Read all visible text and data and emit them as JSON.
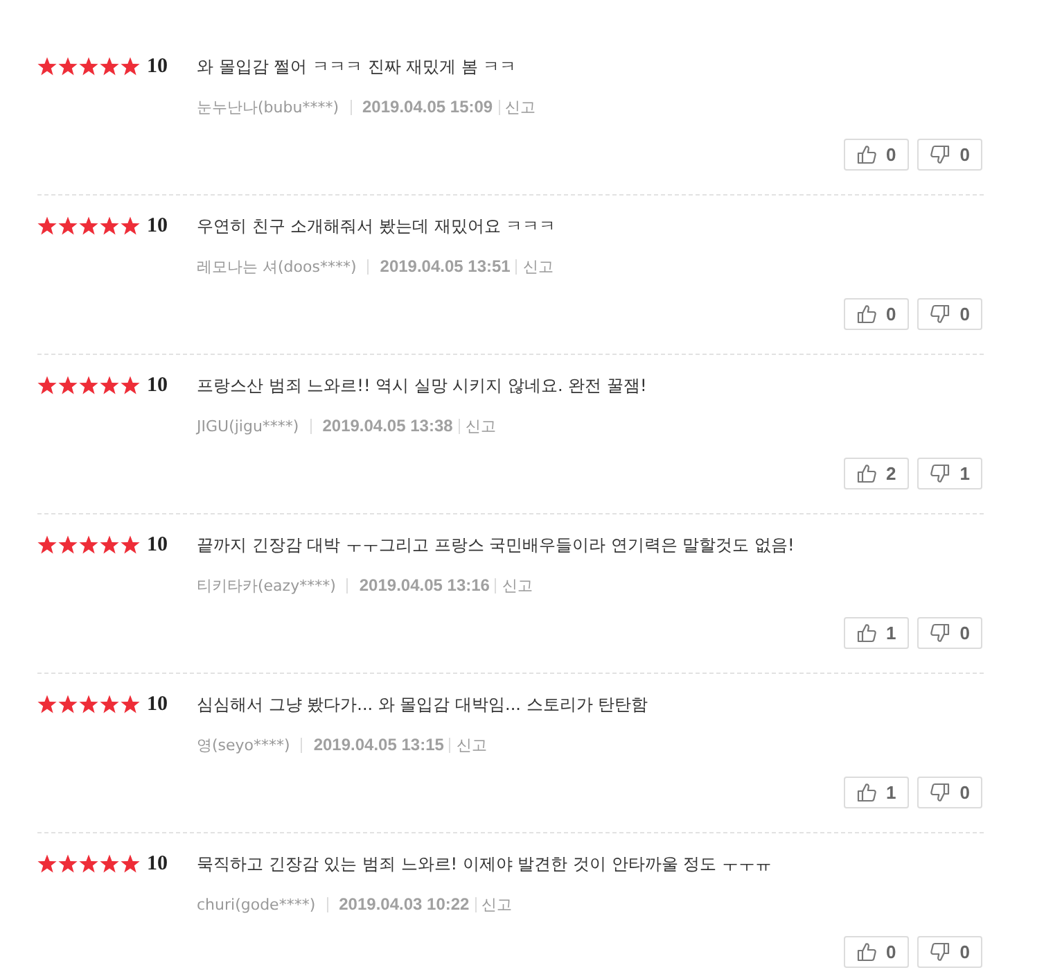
{
  "reviews": [
    {
      "stars": 5,
      "score": "10",
      "comment": "와 몰입감 쩔어 ㅋㅋㅋ 진짜 재밌게 봄 ㅋㅋ",
      "author": "눈누난나(bubu****)",
      "date": "2019.04.05 15:09",
      "report": "신고",
      "likes": "0",
      "dislikes": "0"
    },
    {
      "stars": 5,
      "score": "10",
      "comment": "우연히 친구 소개해줘서 봤는데 재밌어요 ㅋㅋㅋ",
      "author": "레모나는 셔(doos****)",
      "date": "2019.04.05 13:51",
      "report": "신고",
      "likes": "0",
      "dislikes": "0"
    },
    {
      "stars": 5,
      "score": "10",
      "comment": "프랑스산 범죄 느와르!! 역시 실망 시키지 않네요. 완전 꿀잼!",
      "author": "JIGU(jigu****)",
      "date": "2019.04.05 13:38",
      "report": "신고",
      "likes": "2",
      "dislikes": "1"
    },
    {
      "stars": 5,
      "score": "10",
      "comment": "끝까지 긴장감 대박 ㅜㅜ그리고 프랑스 국민배우들이라 연기력은 말할것도 없음!",
      "author": "티키타카(eazy****)",
      "date": "2019.04.05 13:16",
      "report": "신고",
      "likes": "1",
      "dislikes": "0"
    },
    {
      "stars": 5,
      "score": "10",
      "comment": "심심해서 그냥 봤다가... 와 몰입감 대박임... 스토리가 탄탄함",
      "author": "영(seyo****)",
      "date": "2019.04.05 13:15",
      "report": "신고",
      "likes": "1",
      "dislikes": "0"
    },
    {
      "stars": 5,
      "score": "10",
      "comment": "묵직하고 긴장감 있는 범죄 느와르! 이제야 발견한 것이 안타까울 정도 ㅜㅜㅠ",
      "author": "churi(gode****)",
      "date": "2019.04.03 10:22",
      "report": "신고",
      "likes": "0",
      "dislikes": "0"
    }
  ]
}
